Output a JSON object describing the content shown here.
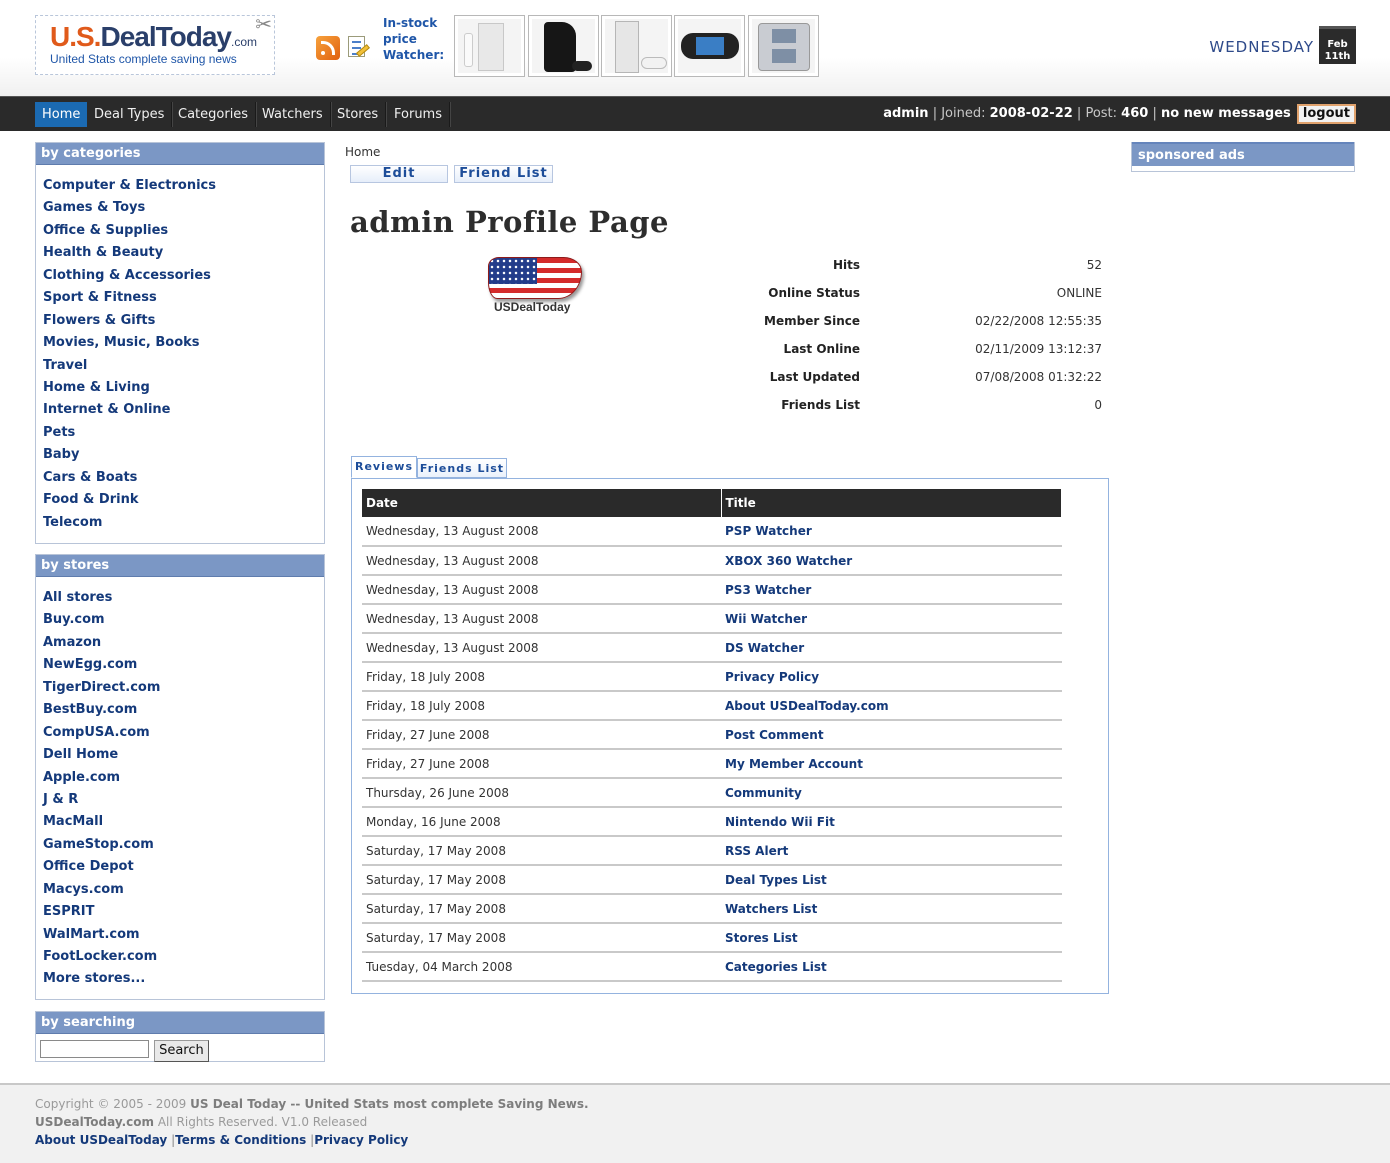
{
  "header": {
    "logo": {
      "brand_us": "U.S.",
      "brand_deal": "DealToday",
      "brand_com": ".com",
      "tagline": "United Stats complete saving news"
    },
    "watcher_label": "In-stock price Watcher:",
    "weekday": "WEDNESDAY",
    "calendar": {
      "month": "Feb",
      "day": "11th"
    },
    "product_icons": [
      "wii-console-icon",
      "ps3-console-icon",
      "xbox360-console-icon",
      "psp-handheld-icon",
      "ds-handheld-icon"
    ]
  },
  "nav": {
    "items": [
      "Home",
      "Deal Types",
      "Categories",
      "Watchers",
      "Stores",
      "Forums"
    ],
    "active": "Home",
    "user": {
      "name": "admin",
      "joined_label": "Joined:",
      "joined": "2008-02-22",
      "post_label": "Post:",
      "posts": "460",
      "messages": "no new messages",
      "logout": "logout"
    }
  },
  "sidebar": {
    "categories_title": "by categories",
    "categories": [
      "Computer & Electronics",
      "Games & Toys",
      "Office & Supplies",
      "Health & Beauty",
      "Clothing & Accessories",
      "Sport & Fitness",
      "Flowers & Gifts",
      "Movies, Music, Books",
      "Travel",
      "Home & Living",
      "Internet & Online",
      "Pets",
      "Baby",
      "Cars & Boats",
      "Food & Drink",
      "Telecom"
    ],
    "stores_title": "by stores",
    "stores": [
      "All stores",
      "Buy.com",
      "Amazon",
      "NewEgg.com",
      "TigerDirect.com",
      "BestBuy.com",
      "CompUSA.com",
      "Dell Home",
      "Apple.com",
      "J & R",
      "MacMall",
      "GameStop.com",
      "Office Depot",
      "Macys.com",
      "ESPRIT",
      "WalMart.com",
      "FootLocker.com",
      "More stores..."
    ],
    "searching_title": "by searching",
    "search_value": "",
    "search_button": "Search"
  },
  "main": {
    "breadcrumb": "Home",
    "buttons": {
      "edit": "Edit",
      "friend_list": "Friend List"
    },
    "title": "admin Profile Page",
    "avatar_caption": "USDealToday",
    "stats": [
      {
        "label": "Hits",
        "value": "52"
      },
      {
        "label": "Online Status",
        "value": "ONLINE"
      },
      {
        "label": "Member Since",
        "value": "02/22/2008 12:55:35"
      },
      {
        "label": "Last Online",
        "value": "02/11/2009 13:12:37"
      },
      {
        "label": "Last Updated",
        "value": "07/08/2008 01:32:22"
      },
      {
        "label": "Friends List",
        "value": "0"
      }
    ],
    "tabs": {
      "reviews": "Reviews",
      "friends": "Friends List"
    },
    "table": {
      "headers": {
        "date": "Date",
        "title": "Title"
      },
      "rows": [
        {
          "date": "Wednesday, 13 August 2008",
          "title": "PSP Watcher"
        },
        {
          "date": "Wednesday, 13 August 2008",
          "title": "XBOX 360 Watcher"
        },
        {
          "date": "Wednesday, 13 August 2008",
          "title": "PS3 Watcher"
        },
        {
          "date": "Wednesday, 13 August 2008",
          "title": "Wii Watcher"
        },
        {
          "date": "Wednesday, 13 August 2008",
          "title": "DS Watcher"
        },
        {
          "date": "Friday, 18 July 2008",
          "title": "Privacy Policy"
        },
        {
          "date": "Friday, 18 July 2008",
          "title": "About USDealToday.com"
        },
        {
          "date": "Friday, 27 June 2008",
          "title": "Post Comment"
        },
        {
          "date": "Friday, 27 June 2008",
          "title": "My Member Account"
        },
        {
          "date": "Thursday, 26 June 2008",
          "title": "Community"
        },
        {
          "date": "Monday, 16 June 2008",
          "title": "Nintendo Wii Fit"
        },
        {
          "date": "Saturday, 17 May 2008",
          "title": "RSS Alert"
        },
        {
          "date": "Saturday, 17 May 2008",
          "title": "Deal Types List"
        },
        {
          "date": "Saturday, 17 May 2008",
          "title": "Watchers List"
        },
        {
          "date": "Saturday, 17 May 2008",
          "title": "Stores List"
        },
        {
          "date": "Tuesday, 04 March 2008",
          "title": "Categories List"
        }
      ]
    }
  },
  "right": {
    "ads_title": "sponsored ads"
  },
  "footer": {
    "copyright_prefix": "Copyright © 2005 - 2009",
    "site_name": "US Deal Today -- United Stats most complete Saving News.",
    "domain": "USDealToday.com",
    "rights": "All Rights Reserved. V1.0 Released",
    "links": [
      "About USDealToday",
      "Terms & Conditions",
      "Privacy Policy"
    ]
  },
  "colors": {
    "nav_bg": "#2a2a2a",
    "nav_active": "#1b6ab2",
    "box_header": "#7b97c5",
    "link": "#14397a",
    "logo_orange": "#e05a1b"
  }
}
